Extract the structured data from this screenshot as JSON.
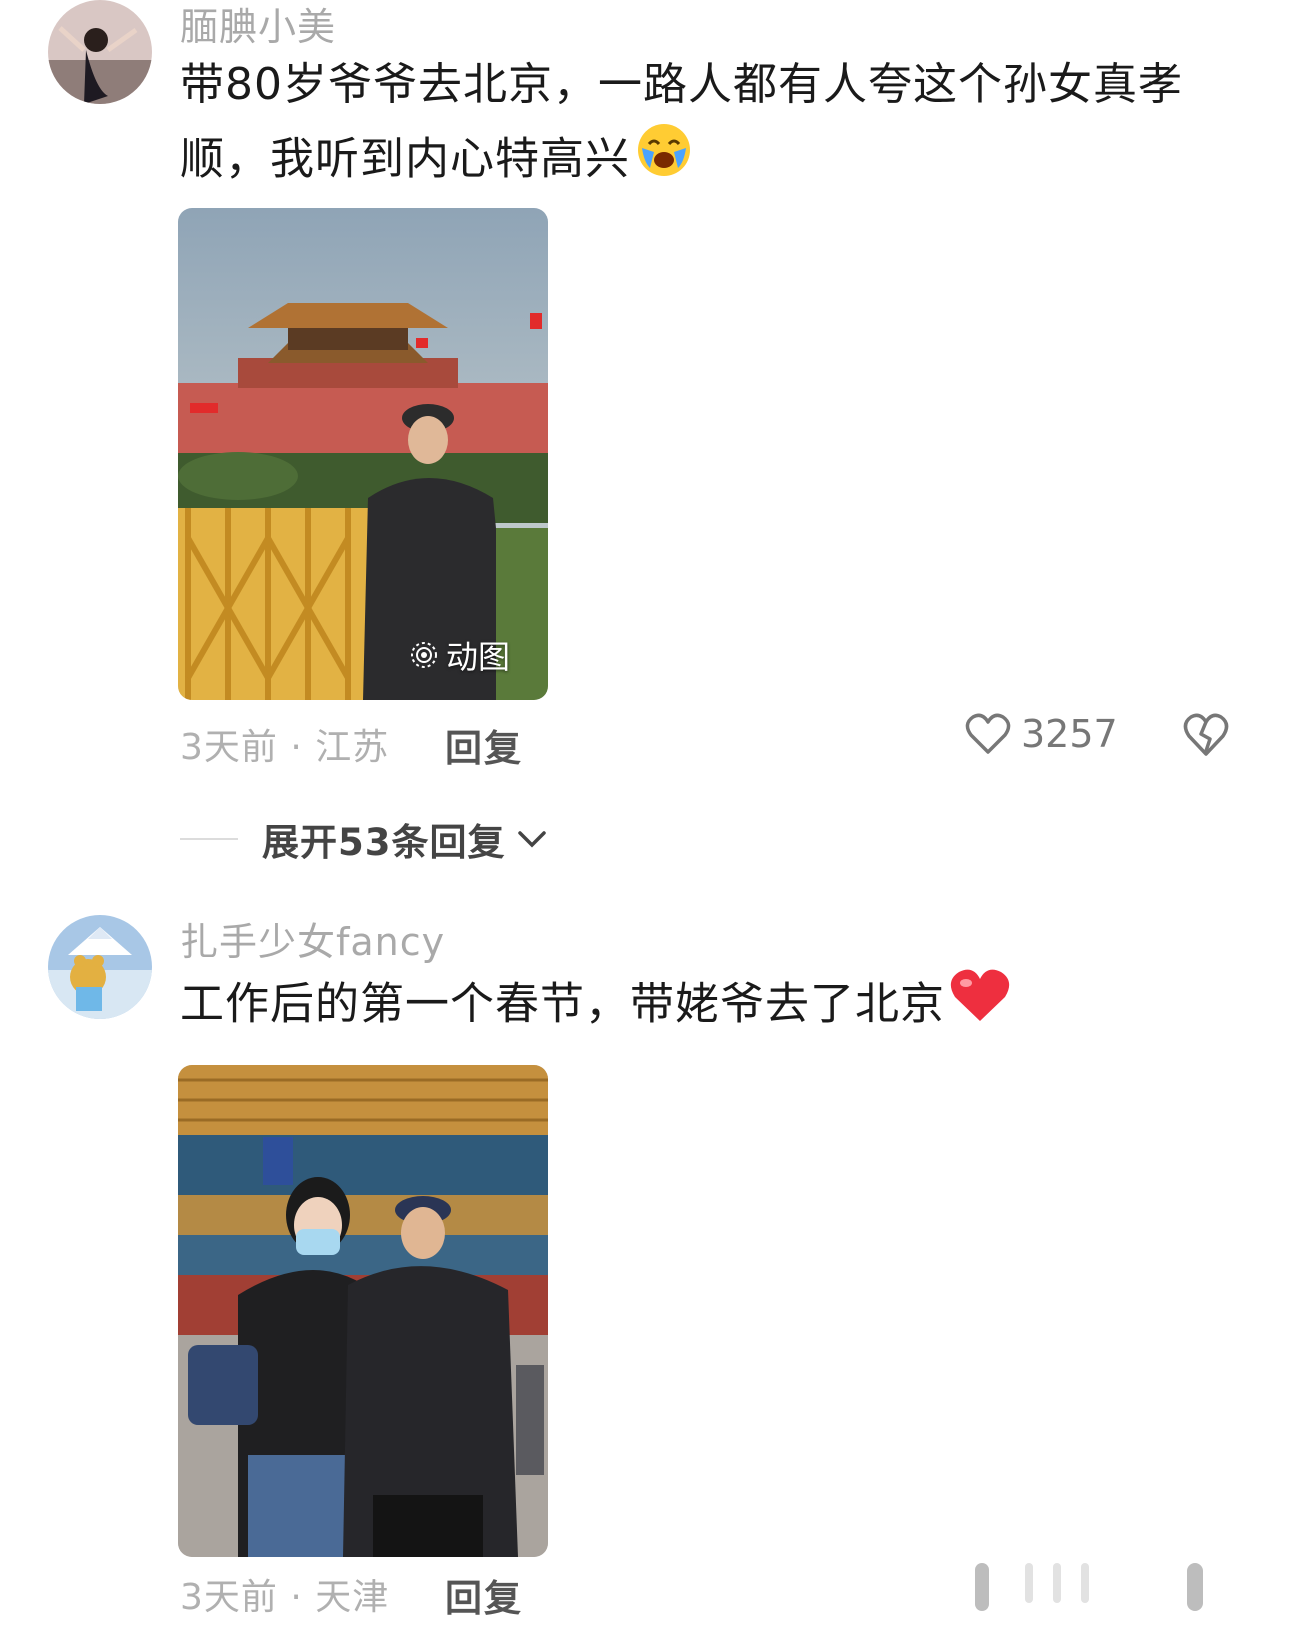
{
  "comments": [
    {
      "username": "腼腆小美",
      "text": "带80岁爷爷去北京，一路人都有人夸这个孙女真孝顺，我听到内心特高兴",
      "emoji": "crying-face-emoji",
      "photo_badge": "动图",
      "meta": "3天前 · 江苏",
      "reply_label": "回复",
      "like_count": "3257",
      "expand_replies": "展开53条回复"
    },
    {
      "username": "扎手少女fancy",
      "text": "工作后的第一个春节，带姥爷去了北京",
      "emoji": "red-heart-emoji",
      "meta": "3天前 · 天津",
      "reply_label": "回复"
    }
  ],
  "colors": {
    "username": "#a9a9a9",
    "text": "#1a1a1a",
    "meta": "#b0b0b0",
    "reply": "#555555",
    "heart": "#e8303f"
  }
}
